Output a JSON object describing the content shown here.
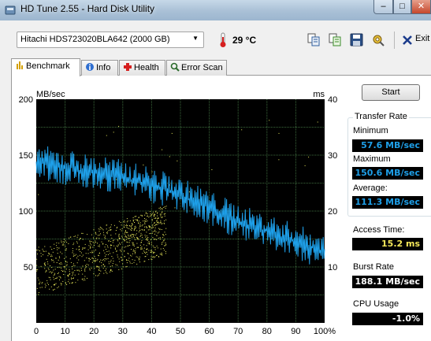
{
  "window": {
    "title": "HD Tune 2.55 - Hard Disk Utility",
    "controls": {
      "minimize": "–",
      "maximize": "□",
      "close": "✕"
    }
  },
  "toolbar": {
    "drive": "Hitachi HDS723020BLA642 (2000 GB)",
    "temperature": "29 °C",
    "icons": [
      "copy-text-icon",
      "copy-info-icon",
      "save-icon",
      "options-icon"
    ],
    "exit_label": "Exit"
  },
  "tabs": [
    {
      "label": "Benchmark",
      "icon": "benchmark-icon",
      "active": true
    },
    {
      "label": "Info",
      "icon": "info-icon",
      "active": false
    },
    {
      "label": "Health",
      "icon": "health-icon",
      "active": false
    },
    {
      "label": "Error Scan",
      "icon": "error-scan-icon",
      "active": false
    }
  ],
  "start_button": "Start",
  "stats": {
    "transfer_rate_title": "Transfer Rate",
    "minimum_label": "Minimum",
    "minimum_value": "57.6 MB/sec",
    "maximum_label": "Maximum",
    "maximum_value": "150.6 MB/sec",
    "average_label": "Average:",
    "average_value": "111.3 MB/sec",
    "access_time_label": "Access Time:",
    "access_time_value": "15.2 ms",
    "burst_rate_label": "Burst Rate",
    "burst_rate_value": "188.1 MB/sec",
    "cpu_usage_label": "CPU Usage",
    "cpu_usage_value": "-1.0%"
  },
  "colors": {
    "chart_bg": "#000000",
    "grid": "#3c6a3c",
    "transfer_line": "#1e9fe8",
    "access_points": "#e8e85a",
    "window_bg": "#f0f0f0"
  },
  "chart_data": {
    "type": "line",
    "left_axis_unit": "MB/sec",
    "right_axis_unit": "ms",
    "left_ticks": [
      "200",
      "150",
      "100",
      "50"
    ],
    "right_ticks": [
      "40",
      "30",
      "20",
      "10"
    ],
    "x_ticks": [
      "0",
      "10",
      "20",
      "30",
      "40",
      "50",
      "60",
      "70",
      "80",
      "90",
      "100%"
    ],
    "xlim": [
      0,
      100
    ],
    "ylim_left": [
      0,
      200
    ],
    "ylim_right": [
      0,
      40
    ],
    "grid": true,
    "series": [
      {
        "axis": "left",
        "style": "line",
        "x": [
          0,
          2,
          4,
          6,
          8,
          10,
          12,
          14,
          16,
          18,
          20,
          22,
          24,
          26,
          28,
          30,
          32,
          34,
          36,
          38,
          40,
          42,
          44,
          46,
          48,
          50,
          52,
          54,
          56,
          58,
          60,
          62,
          64,
          66,
          68,
          70,
          72,
          74,
          76,
          78,
          80,
          82,
          84,
          86,
          88,
          90,
          92,
          94,
          96,
          98,
          100
        ],
        "values": [
          147,
          146,
          145,
          144,
          143,
          141,
          142,
          140,
          139,
          138,
          138,
          136,
          137,
          135,
          134,
          133,
          131,
          130,
          129,
          128,
          126,
          124,
          123,
          121,
          119,
          117,
          115,
          113,
          111,
          109,
          106,
          103,
          101,
          99,
          96,
          94,
          92,
          90,
          88,
          86,
          85,
          83,
          81,
          79,
          78,
          76,
          74,
          72,
          70,
          68,
          66
        ]
      },
      {
        "axis": "right",
        "style": "scatter",
        "x_range": [
          0,
          45
        ],
        "values_range": [
          5,
          21
        ],
        "points": 900
      }
    ]
  }
}
